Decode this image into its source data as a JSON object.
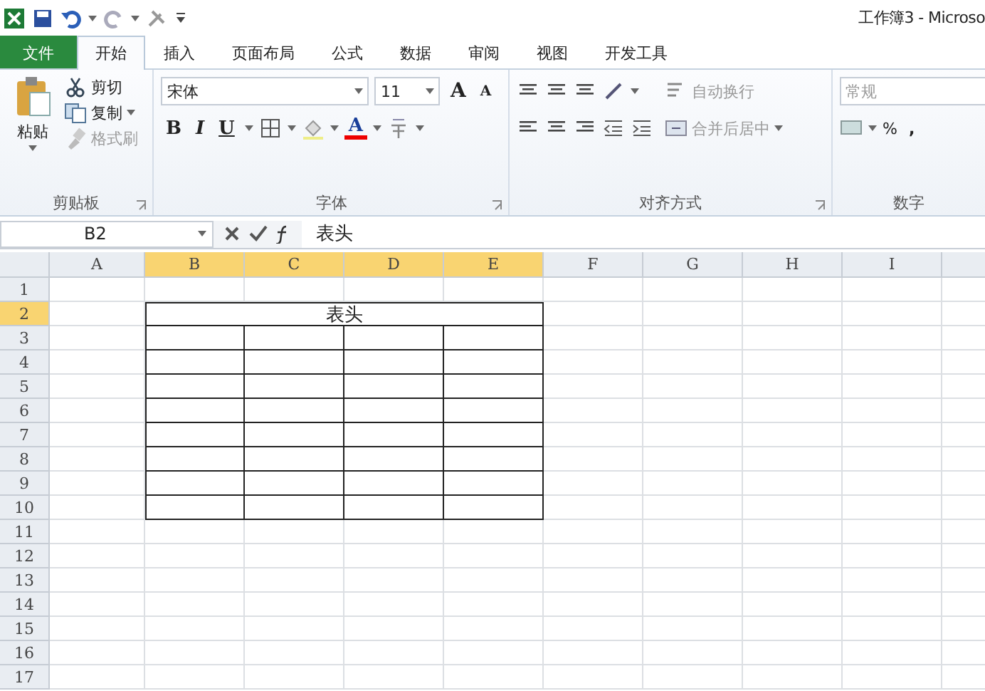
{
  "window": {
    "title": "工作簿3 - Microso"
  },
  "tabs": [
    {
      "label": "文件",
      "kind": "file",
      "selected": false
    },
    {
      "label": "开始",
      "kind": "tab",
      "selected": true
    },
    {
      "label": "插入",
      "kind": "tab",
      "selected": false
    },
    {
      "label": "页面布局",
      "kind": "tab",
      "selected": false
    },
    {
      "label": "公式",
      "kind": "tab",
      "selected": false
    },
    {
      "label": "数据",
      "kind": "tab",
      "selected": false
    },
    {
      "label": "审阅",
      "kind": "tab",
      "selected": false
    },
    {
      "label": "视图",
      "kind": "tab",
      "selected": false
    },
    {
      "label": "开发工具",
      "kind": "tab",
      "selected": false
    }
  ],
  "clipboard": {
    "paste": "粘贴",
    "cut": "剪切",
    "copy": "复制",
    "format_painter": {
      "label": "格式刷",
      "disabled": true
    },
    "group_label": "剪贴板"
  },
  "font": {
    "name": "宋体",
    "size": "11",
    "grow": "A",
    "shrink": "A",
    "bold": "B",
    "italic": "I",
    "underline": "U",
    "color_letter": "A",
    "group_label": "字体"
  },
  "alignment": {
    "wrap_text": "自动换行",
    "merge_center": "合并后居中",
    "group_label": "对齐方式"
  },
  "number": {
    "format": "常规",
    "percent": "%",
    "comma": ",",
    "group_label": "数字"
  },
  "formula_bar": {
    "name_box": "B2",
    "content": "表头"
  },
  "sheet": {
    "columns": [
      {
        "label": "A",
        "selected": false
      },
      {
        "label": "B",
        "selected": true
      },
      {
        "label": "C",
        "selected": true
      },
      {
        "label": "D",
        "selected": true
      },
      {
        "label": "E",
        "selected": true
      },
      {
        "label": "F",
        "selected": false
      },
      {
        "label": "G",
        "selected": false
      },
      {
        "label": "H",
        "selected": false
      },
      {
        "label": "I",
        "selected": false
      }
    ],
    "rows": [
      {
        "label": "1",
        "selected": false
      },
      {
        "label": "2",
        "selected": true
      },
      {
        "label": "3",
        "selected": false
      },
      {
        "label": "4",
        "selected": false
      },
      {
        "label": "5",
        "selected": false
      },
      {
        "label": "6",
        "selected": false
      },
      {
        "label": "7",
        "selected": false
      },
      {
        "label": "8",
        "selected": false
      },
      {
        "label": "9",
        "selected": false
      },
      {
        "label": "10",
        "selected": false
      },
      {
        "label": "11",
        "selected": false
      },
      {
        "label": "12",
        "selected": false
      },
      {
        "label": "13",
        "selected": false
      },
      {
        "label": "14",
        "selected": false
      },
      {
        "label": "15",
        "selected": false
      },
      {
        "label": "16",
        "selected": false
      },
      {
        "label": "17",
        "selected": false
      }
    ],
    "merged_cell": {
      "text": "表头"
    }
  }
}
